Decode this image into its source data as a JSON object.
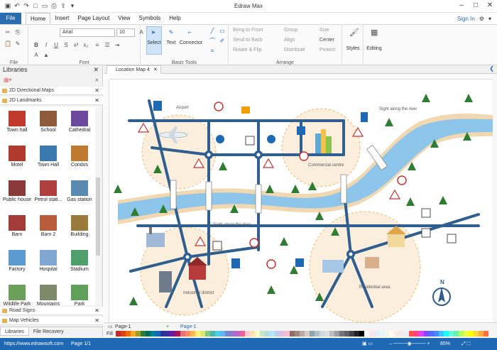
{
  "app": {
    "title": "Edraw Max"
  },
  "menu": {
    "file": "File",
    "tabs": [
      "Home",
      "Insert",
      "Page Layout",
      "View",
      "Symbols",
      "Help"
    ],
    "sign_in": "Sign In"
  },
  "ribbon": {
    "font_name": "Arial",
    "font_size": "10",
    "groups": {
      "file": "File",
      "font": "Font",
      "basic_tools": "Basic Tools",
      "arrange": "Arrange"
    },
    "select": "Select",
    "text": "Text",
    "connector": "Connector",
    "bring_to_front": "Bring to Front",
    "send_to_back": "Send to Back",
    "rotate_flip": "Rotate & Flip",
    "group": "Group",
    "align": "Align",
    "distribute": "Distribute",
    "size": "Size",
    "center": "Center",
    "protect": "Protect",
    "styles": "Styles",
    "editing": "Editing"
  },
  "libraries": {
    "title": "Libraries",
    "sections": [
      "2D Directional Maps",
      "2D Landmarks"
    ],
    "items": [
      "Town hall",
      "School",
      "Cathedral",
      "Motel",
      "Town Hall",
      "Condos",
      "Public house",
      "Petrol stati...",
      "Gas station",
      "Barn",
      "Barn 2",
      "Building",
      "Factory",
      "Hospital",
      "Stadium",
      "Wildlife Park",
      "Mountains",
      "Park"
    ],
    "bottom_sections": [
      "Road Signs",
      "Map Vehicles"
    ],
    "tabs": [
      "Libraries",
      "File Recovery"
    ]
  },
  "document": {
    "tab": "Location Map 4"
  },
  "map": {
    "labels": [
      "Airport",
      "Sight along the river",
      "Commercial centre",
      "Sight along the river",
      "Industrial district",
      "Residential area"
    ],
    "compass": "N"
  },
  "pages": {
    "tab1": "Page-1",
    "tab2": "Page-1",
    "add": "+"
  },
  "palette": {
    "fill_label": "Fill",
    "colors": [
      "#c62828",
      "#d84315",
      "#ef6c00",
      "#f9a825",
      "#9e9d24",
      "#2e7d32",
      "#00695c",
      "#00838f",
      "#1565c0",
      "#283593",
      "#4527a0",
      "#6a1b9a",
      "#ad1457",
      "#e57373",
      "#ff8a65",
      "#ffb74d",
      "#fff176",
      "#dce775",
      "#81c784",
      "#4db6ac",
      "#4dd0e1",
      "#64b5f6",
      "#7986cb",
      "#9575cd",
      "#ba68c8",
      "#f06292",
      "#ffcdd2",
      "#ffe0b2",
      "#fff9c4",
      "#c8e6c9",
      "#b2dfdb",
      "#b3e5fc",
      "#c5cae9",
      "#e1bee7",
      "#f8bbd0",
      "#8d6e63",
      "#a1887f",
      "#bcaaa4",
      "#d7ccc8",
      "#90a4ae",
      "#b0bec5",
      "#cfd8dc",
      "#e0e0e0",
      "#bdbdbd",
      "#9e9e9e",
      "#757575",
      "#616161",
      "#424242",
      "#212121",
      "#000000",
      "#ffffff",
      "#fce4ec",
      "#e8eaf6",
      "#e0f7fa",
      "#f1f8e9",
      "#fffde7",
      "#fbe9e7",
      "#efebe9",
      "#eceff1",
      "#ff5252",
      "#ff4081",
      "#e040fb",
      "#7c4dff",
      "#536dfe",
      "#448aff",
      "#40c4ff",
      "#18ffff",
      "#64ffda",
      "#69f0ae",
      "#b2ff59",
      "#eeff41",
      "#ffff00",
      "#ffd740",
      "#ffab40",
      "#ff6e40"
    ]
  },
  "status": {
    "url": "https://www.edrawsoft.com",
    "page": "Page 1/1",
    "zoom": "85%"
  }
}
